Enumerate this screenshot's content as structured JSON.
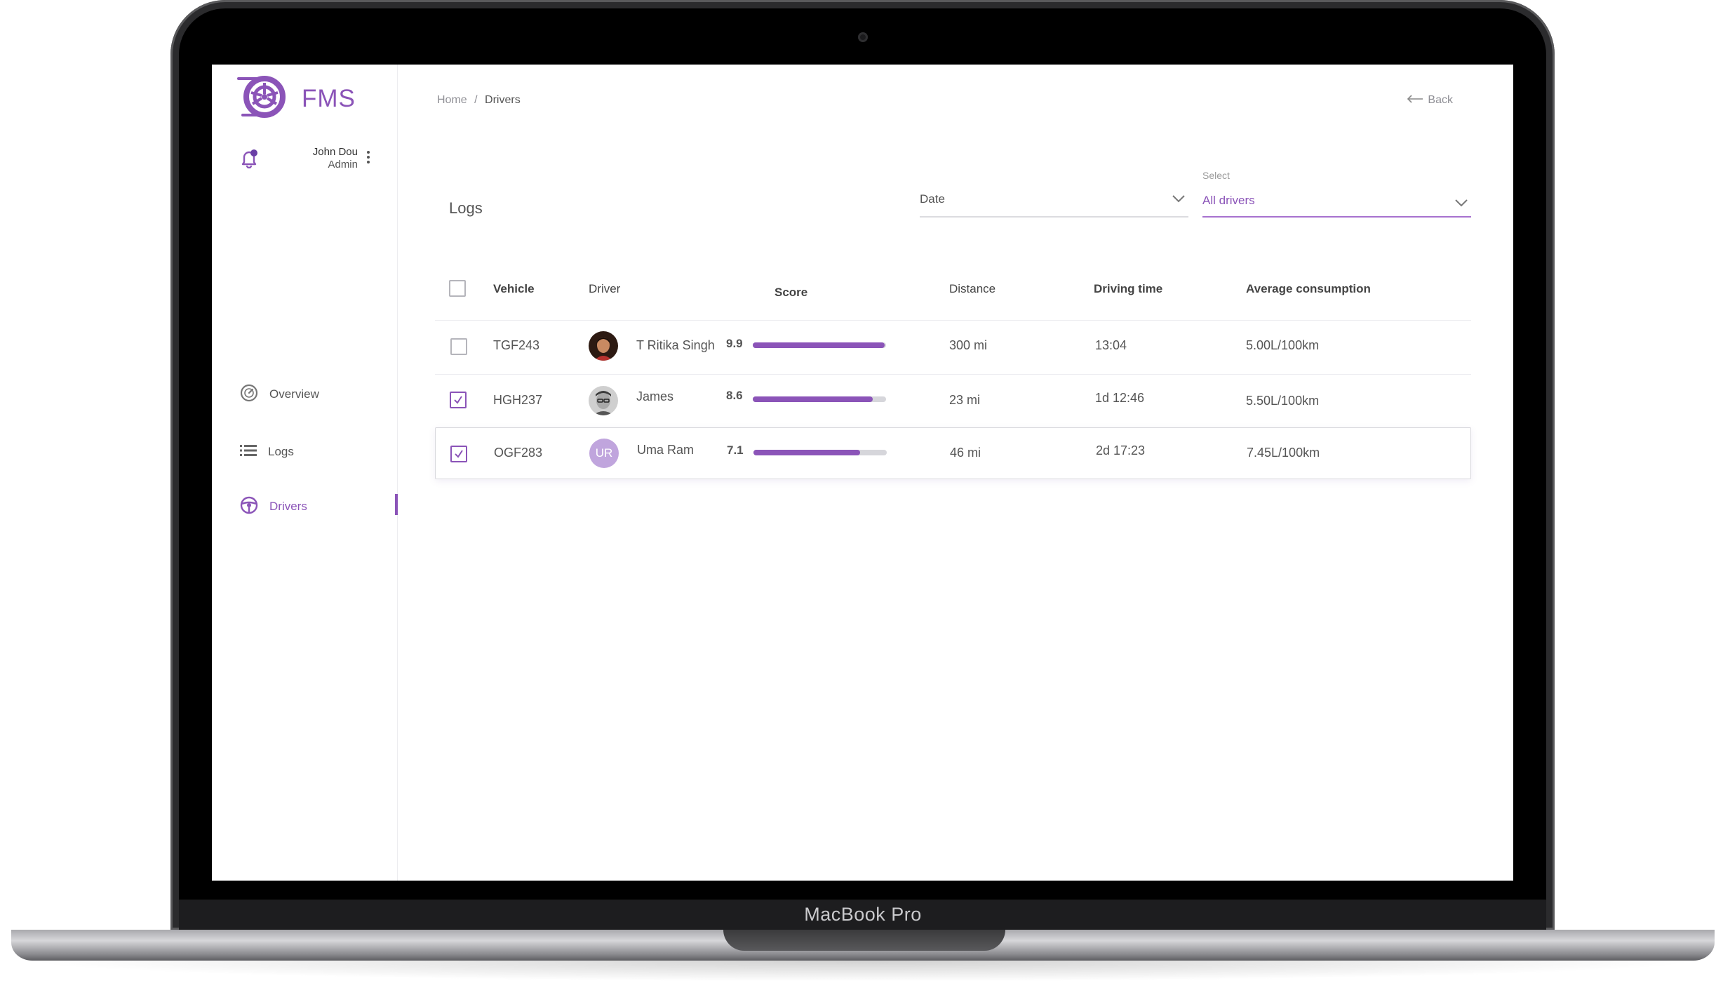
{
  "device": {
    "brand_label": "MacBook Pro"
  },
  "app": {
    "name": "FMS",
    "accent_color": "#8b54b8",
    "user": {
      "name": "John Dou",
      "role": "Admin"
    }
  },
  "sidebar": {
    "items": [
      {
        "label": "Overview",
        "icon": "speedometer-icon",
        "active": false
      },
      {
        "label": "Logs",
        "icon": "list-icon",
        "active": false
      },
      {
        "label": "Drivers",
        "icon": "steering-wheel-icon",
        "active": true
      }
    ]
  },
  "header": {
    "breadcrumb": {
      "home": "Home",
      "separator": "/",
      "current": "Drivers"
    },
    "back_label": "Back"
  },
  "logs": {
    "title": "Logs",
    "date_filter": {
      "value": "Date"
    },
    "driver_filter": {
      "label": "Select",
      "value": "All drivers"
    },
    "columns": [
      "Vehicle",
      "Driver",
      "Score",
      "Distance",
      "Driving time",
      "Average consumption"
    ],
    "rows": [
      {
        "checked": false,
        "vehicle": "TGF243",
        "driver": "T Ritika Singh",
        "avatar": "photo",
        "score": "9.9",
        "score_fraction": 0.99,
        "distance": "300 mi",
        "driving_time": "13:04",
        "avg_consumption": "5.00L/100km"
      },
      {
        "checked": true,
        "vehicle": "HGH237",
        "driver": "James",
        "avatar": "photo",
        "score": "8.6",
        "score_fraction": 0.9,
        "distance": "23 mi",
        "driving_time": "1d 12:46",
        "avg_consumption": "5.50L/100km"
      },
      {
        "checked": true,
        "vehicle": "OGF283",
        "driver": "Uma Ram",
        "avatar": "initials",
        "initials": "UR",
        "score": "7.1",
        "score_fraction": 0.8,
        "distance": "46 mi",
        "driving_time": "2d 17:23",
        "avg_consumption": "7.45L/100km"
      }
    ]
  }
}
